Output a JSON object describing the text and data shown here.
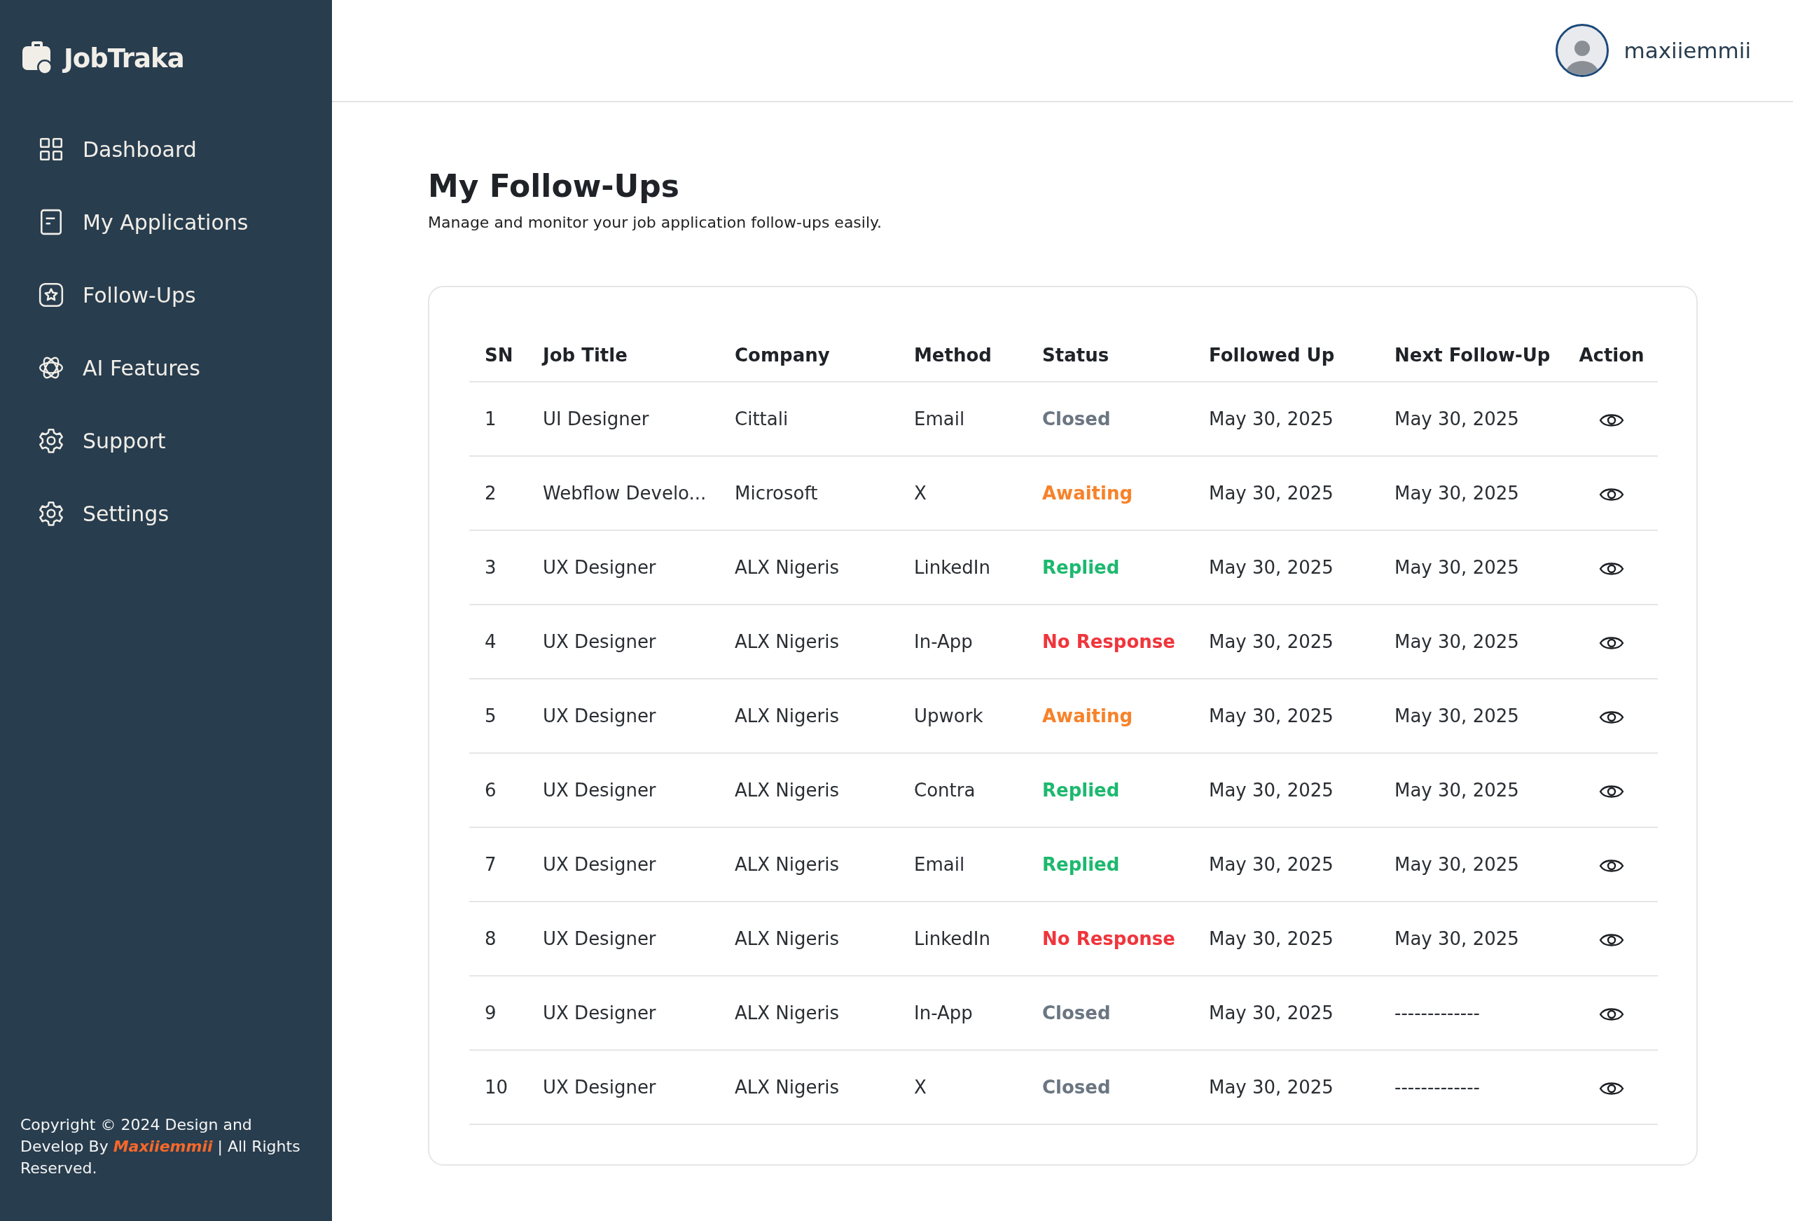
{
  "sidebar": {
    "logo": "JobTraka",
    "items": [
      {
        "label": "Dashboard",
        "selected": false
      },
      {
        "label": "My Applications",
        "selected": false
      },
      {
        "label": "Follow-Ups",
        "selected": false
      },
      {
        "label": "AI Features",
        "selected": false
      },
      {
        "label": "Support",
        "selected": false
      },
      {
        "label": "Settings",
        "selected": false
      }
    ],
    "footer": {
      "before": "Copyright © 2024 Design and Develop By",
      "author": "Maxiiemmii",
      "after": "| All Rights Reserved."
    }
  },
  "header": {
    "username": "maxiiemmii"
  },
  "page": {
    "title": "My Follow-Ups",
    "subtitle": "Manage and monitor your job application follow-ups easily."
  },
  "table": {
    "columns": [
      "SN",
      "Job Title",
      "Company",
      "Method",
      "Status",
      "Followed Up",
      "Next Follow-Up",
      "Action"
    ],
    "rows": [
      {
        "sn": "1",
        "job_title": "UI Designer",
        "company": "Cittali",
        "method": "Email",
        "status": "Closed",
        "color": "#6b7682",
        "followed_up": "May 30, 2025",
        "next_follow_up": "May 30, 2025"
      },
      {
        "sn": "2",
        "job_title": "Webflow Develo...",
        "company": "Microsoft",
        "method": "X",
        "status": "Awaiting",
        "color": "#f7822a",
        "followed_up": "May 30, 2025",
        "next_follow_up": "May 30, 2025"
      },
      {
        "sn": "3",
        "job_title": "UX Designer",
        "company": "ALX Nigeris",
        "method": "LinkedIn",
        "status": "Replied",
        "color": "#1db96f",
        "followed_up": "May 30, 2025",
        "next_follow_up": "May 30, 2025"
      },
      {
        "sn": "4",
        "job_title": "UX Designer",
        "company": "ALX Nigeris",
        "method": "In-App",
        "status": "No Response",
        "color": "#f0353c",
        "followed_up": "May 30, 2025",
        "next_follow_up": "May 30, 2025"
      },
      {
        "sn": "5",
        "job_title": "UX Designer",
        "company": "ALX Nigeris",
        "method": "Upwork",
        "status": "Awaiting",
        "color": "#f7822a",
        "followed_up": "May 30, 2025",
        "next_follow_up": "May 30, 2025"
      },
      {
        "sn": "6",
        "job_title": "UX Designer",
        "company": "ALX Nigeris",
        "method": "Contra",
        "status": "Replied",
        "color": "#1db96f",
        "followed_up": "May 30, 2025",
        "next_follow_up": "May 30, 2025"
      },
      {
        "sn": "7",
        "job_title": "UX Designer",
        "company": "ALX Nigeris",
        "method": "Email",
        "status": "Replied",
        "color": "#1db96f",
        "followed_up": "May 30, 2025",
        "next_follow_up": "May 30, 2025"
      },
      {
        "sn": "8",
        "job_title": "UX Designer",
        "company": "ALX Nigeris",
        "method": "LinkedIn",
        "status": "No Response",
        "color": "#f0353c",
        "followed_up": "May 30, 2025",
        "next_follow_up": "May 30, 2025"
      },
      {
        "sn": "9",
        "job_title": "UX Designer",
        "company": "ALX Nigeris",
        "method": "In-App",
        "status": "Closed",
        "color": "#6b7682",
        "followed_up": "May 30, 2025",
        "next_follow_up": "-------------"
      },
      {
        "sn": "10",
        "job_title": "UX Designer",
        "company": "ALX Nigeris",
        "method": "X",
        "status": "Closed",
        "color": "#6b7682",
        "followed_up": "May 30, 2025",
        "next_follow_up": "-------------"
      }
    ]
  }
}
